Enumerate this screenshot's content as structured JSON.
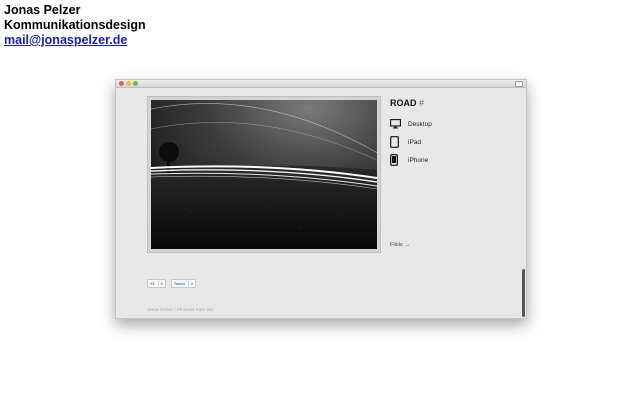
{
  "header": {
    "name": "Jonas Pelzer",
    "role": "Kommunikationsdesign",
    "email": "mail@jonaspelzer.de"
  },
  "window": {
    "post": {
      "title": "ROAD",
      "permalink_symbol": "#",
      "downloads": [
        {
          "label": "Desktop",
          "icon": "monitor-icon"
        },
        {
          "label": "iPad",
          "icon": "tablet-icon"
        },
        {
          "label": "iPhone",
          "icon": "phone-icon"
        }
      ],
      "flickr_link": "Flickr →"
    },
    "social": {
      "gplus": {
        "label": "+1",
        "count": "0"
      },
      "tweet": {
        "label": "Tweet",
        "count": "0"
      }
    },
    "footer_text": "Jonas Pelzer / Photoset Kate Set"
  },
  "colors": {
    "page_background": "#ffffff",
    "window_background": "#e8e8e8",
    "link_blue": "#1a22a8",
    "traffic_red": "#ee5b52",
    "traffic_yellow": "#f2be30",
    "traffic_green": "#5cc448"
  }
}
